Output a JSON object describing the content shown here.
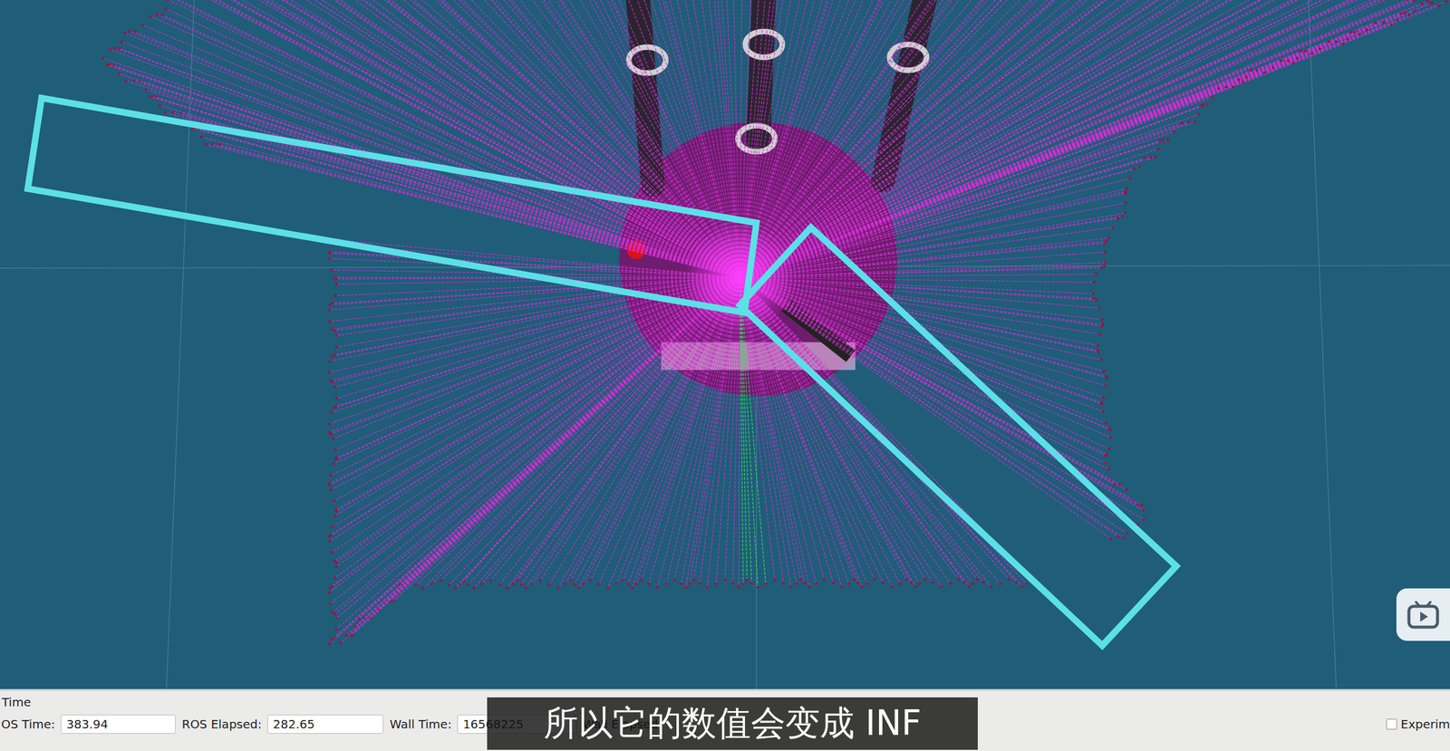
{
  "time_panel": {
    "title": "Time",
    "fields": [
      {
        "label": "OS Time:",
        "value": "383.94"
      },
      {
        "label": "ROS Elapsed:",
        "value": "282.65"
      },
      {
        "label": "Wall Time:",
        "value": "16568225"
      },
      {
        "label": "Wall Elapsed"
      }
    ],
    "experimental": {
      "label": "Experim",
      "checked": false
    }
  },
  "subtitle": "所以它的数值会变成 INF"
}
